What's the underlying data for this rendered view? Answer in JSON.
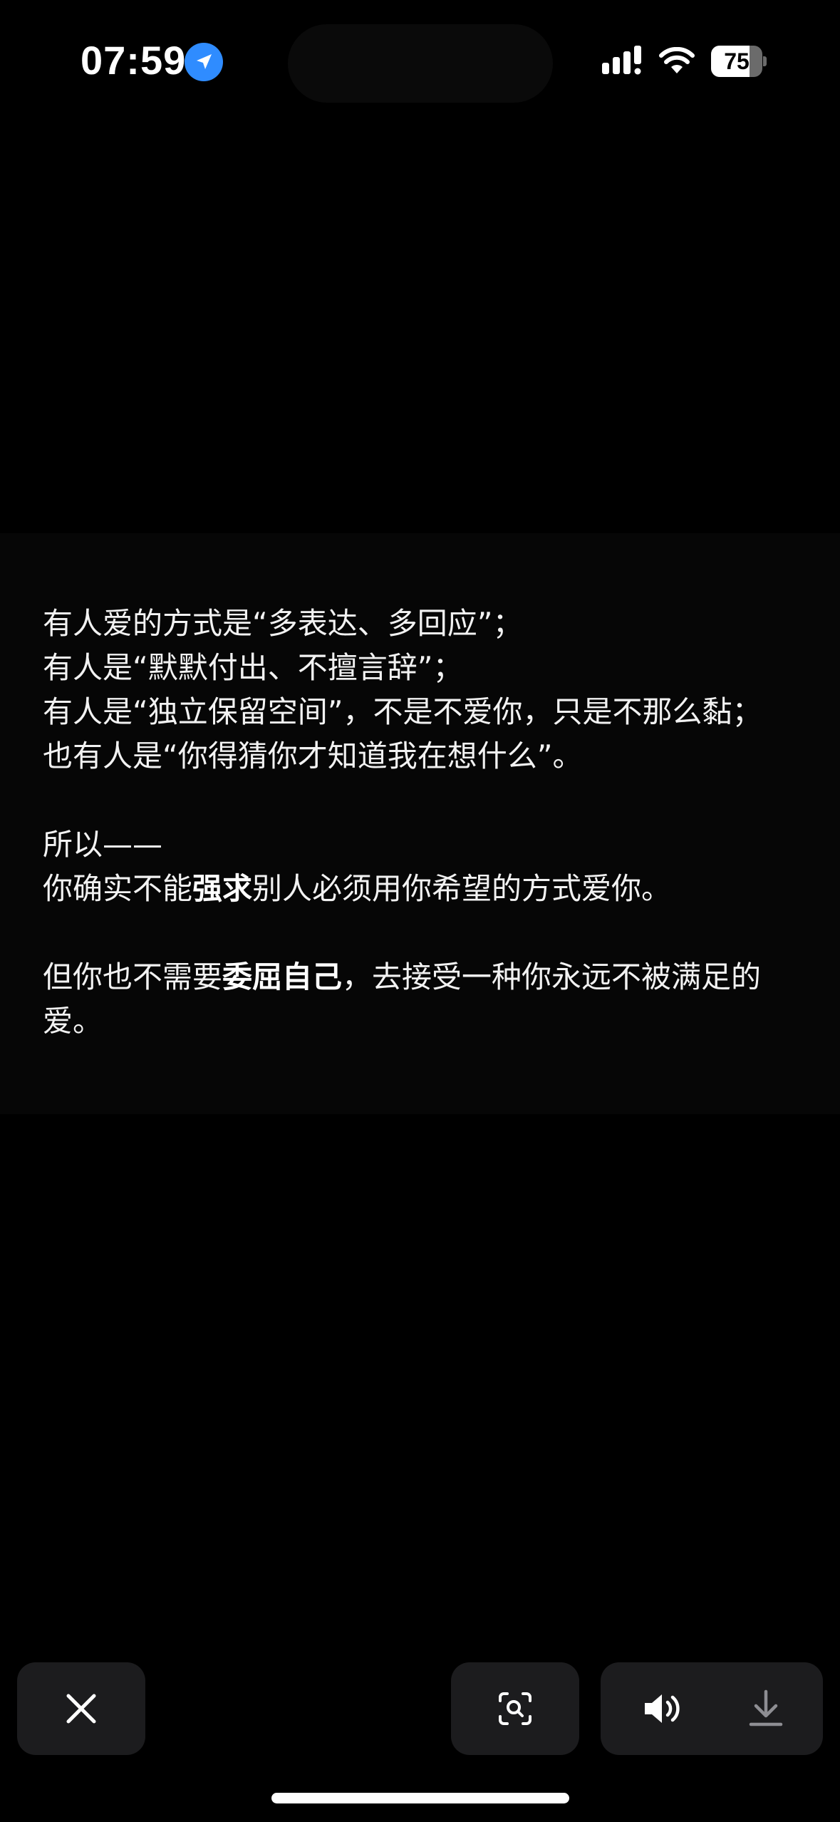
{
  "status_bar": {
    "time": "07:59",
    "battery_level": "75",
    "battery_fraction": 0.75
  },
  "content": {
    "l1": "有人爱的方式是“多表达、多回应”；",
    "l2": "有人是“默默付出、不擅言辞”；",
    "l3": "有人是“独立保留空间”，不是不爱你，只是不那么黏；",
    "l4": "也有人是“你得猜你才知道我在想什么”。",
    "l5": "所以——",
    "l6_a": "你确实不能",
    "l6_bold": "强求",
    "l6_b": "别人必须用你希望的方式爱你。",
    "l7_a": "但你也不需要",
    "l7_bold": "委屈自己",
    "l7_b": "，去接受一种你永远不被满足的爱。"
  },
  "toolbar": {
    "close_icon": "close-icon",
    "scan_icon": "text-scan-icon",
    "sound_icon": "speaker-icon",
    "download_icon": "download-icon"
  },
  "colors": {
    "background": "#000000",
    "card": "#060606",
    "button": "#1c1c1e",
    "location_accent": "#2f8cff"
  }
}
